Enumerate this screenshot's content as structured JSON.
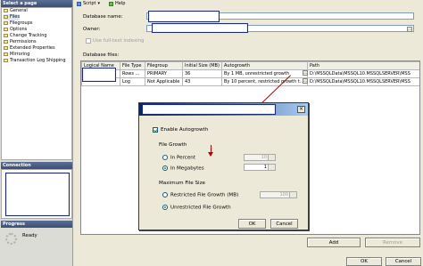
{
  "left_panel": {
    "select_page_header": "Select a page",
    "pages": [
      "General",
      "Files",
      "Filegroups",
      "Options",
      "Change Tracking",
      "Permissions",
      "Extended Properties",
      "Mirroring",
      "Transaction Log Shipping"
    ],
    "connection_header": "Connection",
    "progress_header": "Progress",
    "progress_status": "Ready"
  },
  "toolbar": {
    "script_label": "Script",
    "help_label": "Help"
  },
  "form": {
    "database_name_label": "Database name:",
    "owner_label": "Owner:",
    "fulltext_label": "Use full-text indexing",
    "database_files_label": "Database files:"
  },
  "grid": {
    "headers": [
      "Logical Name",
      "File Type",
      "Filegroup",
      "Initial Size (MB)",
      "Autogrowth",
      "Path"
    ],
    "rows": [
      {
        "logical": "",
        "type": "Rows ...",
        "filegroup": "PRIMARY",
        "size": "36",
        "autogrowth": "By 1 MB, unrestricted growth",
        "path": "D:\\MSSQLData\\MSSQL10.MSSQLSERVER\\MSS"
      },
      {
        "logical": "",
        "type": "Log",
        "filegroup": "Not Applicable",
        "size": "43",
        "autogrowth": "By 10 percent, restricted growth t...",
        "path": "D:\\MSSQLData\\MSSQL10.MSSQLSERVER\\MSS"
      }
    ]
  },
  "buttons": {
    "add": "Add",
    "remove": "Remove",
    "ok": "OK",
    "cancel": "Cancel"
  },
  "dialog": {
    "enable_autogrowth": "Enable Autogrowth",
    "file_growth_label": "File Growth",
    "in_percent": "In Percent",
    "percent_value": "10",
    "in_megabytes": "In Megabytes",
    "mb_value": "1",
    "max_file_size_label": "Maximum File Size",
    "restricted_label": "Restricted File Growth (MB)",
    "restricted_value": "100",
    "unrestricted_label": "Unrestricted File Growth",
    "ok": "OK",
    "cancel": "Cancel",
    "enable_checked": true,
    "growth_mode": "In Megabytes",
    "max_mode": "Unrestricted File Growth"
  },
  "colors": {
    "title_bar": "#3b4e74",
    "dialog_title": "#0a246a",
    "annotation_arrow": "#b30000",
    "check_mark": "#21a121"
  }
}
